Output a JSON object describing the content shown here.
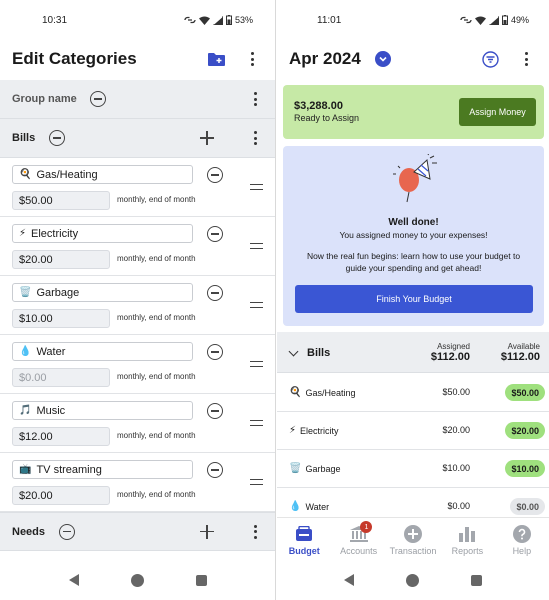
{
  "left": {
    "status": {
      "time": "10:31",
      "battery": "53%"
    },
    "title": "Edit Categories",
    "group_header": {
      "label": "Group name"
    },
    "groups": [
      {
        "name": "Bills"
      },
      {
        "name": "Needs"
      }
    ],
    "categories": [
      {
        "emoji": "🍳",
        "name": "Gas/Heating",
        "amount": "$50.00",
        "freq": "monthly, end of month"
      },
      {
        "emoji": "⚡",
        "name": "Electricity",
        "amount": "$20.00",
        "freq": "monthly, end of month"
      },
      {
        "emoji": "🗑️",
        "name": "Garbage",
        "amount": "$10.00",
        "freq": "monthly, end of month"
      },
      {
        "emoji": "💧",
        "name": "Water",
        "amount": "$0.00",
        "freq": "monthly, end of month"
      },
      {
        "emoji": "🎵",
        "name": "Music",
        "amount": "$12.00",
        "freq": "monthly, end of month"
      },
      {
        "emoji": "📺",
        "name": "TV streaming",
        "amount": "$20.00",
        "freq": "monthly, end of month"
      }
    ]
  },
  "right": {
    "status": {
      "time": "11:01",
      "battery": "49%"
    },
    "month": "Apr 2024",
    "ready": {
      "amount": "$3,288.00",
      "label": "Ready to Assign",
      "button": "Assign Money"
    },
    "done": {
      "heading": "Well done!",
      "line1": "You assigned money to your expenses!",
      "line2": "Now the real fun begins: learn how to use your budget to guide your spending and get ahead!",
      "button": "Finish Your Budget"
    },
    "bills": {
      "name": "Bills",
      "assigned_label": "Assigned",
      "assigned_value": "$112.00",
      "available_label": "Available",
      "available_value": "$112.00",
      "rows": [
        {
          "emoji": "🍳",
          "name": "Gas/Heating",
          "assigned": "$50.00",
          "available": "$50.00"
        },
        {
          "emoji": "⚡",
          "name": "Electricity",
          "assigned": "$20.00",
          "available": "$20.00"
        },
        {
          "emoji": "🗑️",
          "name": "Garbage",
          "assigned": "$10.00",
          "available": "$10.00"
        },
        {
          "emoji": "💧",
          "name": "Water",
          "assigned": "$0.00",
          "available": "$0.00"
        }
      ]
    },
    "tabs": [
      {
        "label": "Budget",
        "icon": "budget-icon"
      },
      {
        "label": "Accounts",
        "icon": "bank-icon",
        "badge": "1"
      },
      {
        "label": "Transaction",
        "icon": "plus-circle-icon"
      },
      {
        "label": "Reports",
        "icon": "bar-chart-icon"
      },
      {
        "label": "Help",
        "icon": "help-icon"
      }
    ]
  },
  "colors": {
    "accent": "#3a4ec7",
    "ready_bg": "#c6e9a6",
    "assign_btn": "#4b7a21",
    "pill_green": "#9fe07e",
    "card_blue": "#dbe2fa"
  }
}
